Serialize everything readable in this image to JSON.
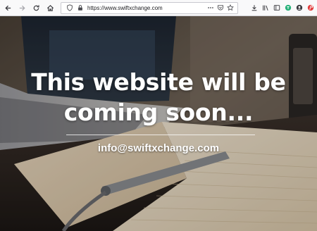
{
  "browser": {
    "url": "https://www.swiftxchange.com",
    "icons": {
      "nav": [
        "back-arrow-icon",
        "forward-arrow-icon",
        "reload-icon",
        "home-icon"
      ],
      "urlbar_left": [
        "shield-icon",
        "lock-icon"
      ],
      "urlbar_right": [
        "more-icon",
        "pocket-icon",
        "bookmark-star-icon"
      ],
      "toolbar_right": [
        "download-icon",
        "library-icon",
        "sidebar-icon",
        "extension-green-icon",
        "account-icon",
        "extension-red-icon"
      ]
    }
  },
  "hero": {
    "headline": "This website will be coming soon...",
    "contact_email": "info@swiftxchange.com"
  },
  "colors": {
    "headline_text": "#ffffff",
    "toolbar_bg": "#f9f9fa",
    "extension_green": "#2ab27b",
    "extension_red": "#e23d3d"
  }
}
